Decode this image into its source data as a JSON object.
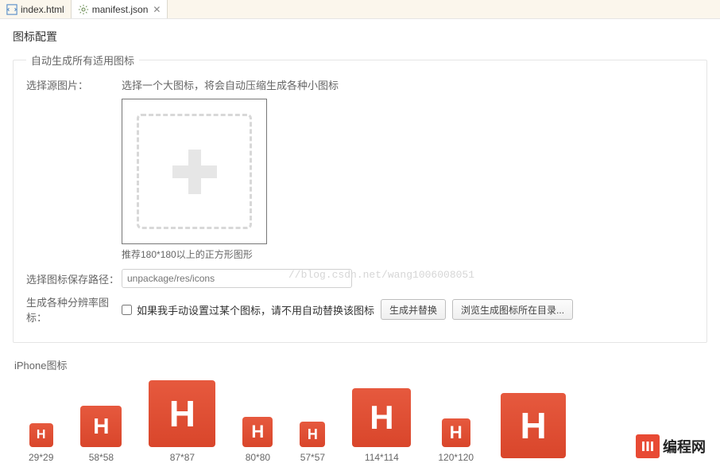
{
  "tabs": {
    "0": {
      "label": "index.html"
    },
    "1": {
      "label": "manifest.json"
    }
  },
  "section_title": "图标配置",
  "auto_group_legend": "自动生成所有适用图标",
  "source": {
    "label": "选择源图片：",
    "hint": "选择一个大图标，将会自动压缩生成各种小图标",
    "recommend": "推荐180*180以上的正方形图形"
  },
  "watermark": "//blog.csdn.net/wang1006008051",
  "save_path": {
    "label": "选择图标保存路径：",
    "placeholder": "unpackage/res/icons"
  },
  "gen_row": {
    "label": "生成各种分辨率图标：",
    "checkbox_text": "如果我手动设置过某个图标，请不用自动替换该图标",
    "btn_generate": "生成并替换",
    "btn_browse": "浏览生成图标所在目录..."
  },
  "iphone_title": "iPhone图标",
  "icons": {
    "0": {
      "label": "29*29"
    },
    "1": {
      "label": "58*58"
    },
    "2": {
      "label": "87*87"
    },
    "3": {
      "label": "80*80"
    },
    "4": {
      "label": "57*57"
    },
    "5": {
      "label": "114*114"
    },
    "6": {
      "label": "120*120"
    }
  },
  "brand": {
    "text": "编程网"
  }
}
